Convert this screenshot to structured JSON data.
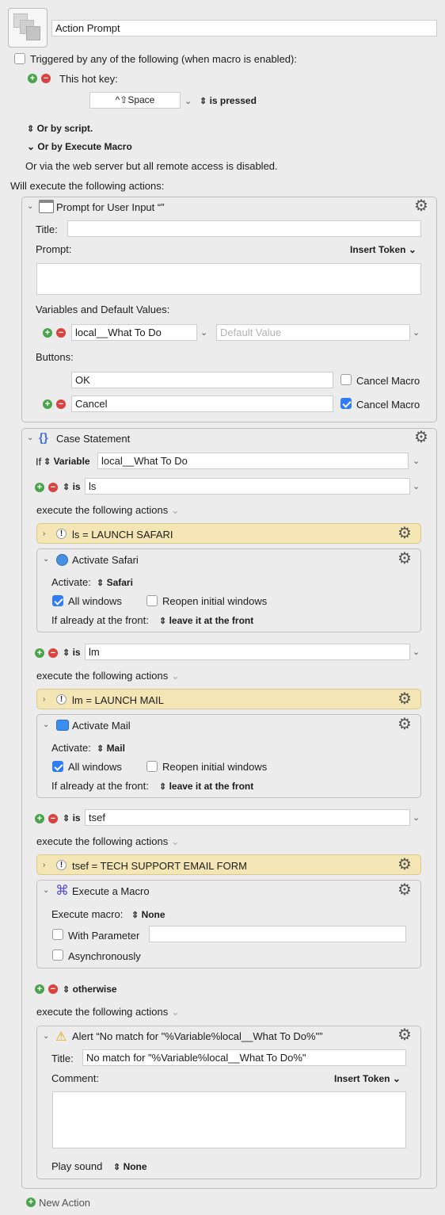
{
  "macro": {
    "name": "Action Prompt"
  },
  "trigger": {
    "triggered_label": "Triggered by any of the following (when macro is enabled):",
    "hotkey_label": "This hot key:",
    "hotkey_value": "^⇧Space",
    "hotkey_state": "is pressed",
    "or_script": "Or by script.",
    "or_execute": "Or by Execute Macro",
    "web_server": "Or via the web server but all remote access is disabled."
  },
  "will_execute": "Will execute the following actions:",
  "prompt": {
    "title": "Prompt for User Input “”",
    "title_label": "Title:",
    "prompt_label": "Prompt:",
    "insert_token": "Insert Token",
    "vars_label": "Variables and Default Values:",
    "var_name": "local__What To Do",
    "default_placeholder": "Default Value",
    "buttons_label": "Buttons:",
    "buttons": [
      {
        "label": "OK",
        "cancel": "Cancel Macro",
        "checked": false
      },
      {
        "label": "Cancel",
        "cancel": "Cancel Macro",
        "checked": true
      }
    ]
  },
  "case": {
    "title": "Case Statement",
    "if_label": "If",
    "variable_label": "Variable",
    "variable": "local__What To Do",
    "is_label": "is",
    "execute_label": "execute the following actions",
    "cases": [
      {
        "value": "ls",
        "comment": "ls = LAUNCH SAFARI",
        "action": "Activate Safari",
        "activate_label": "Activate:",
        "app": "Safari",
        "all_windows": "All windows",
        "reopen": "Reopen initial windows",
        "front_label": "If already at the front:",
        "front_value": "leave it at the front"
      },
      {
        "value": "lm",
        "comment": "lm = LAUNCH MAIL",
        "action": "Activate Mail",
        "activate_label": "Activate:",
        "app": "Mail",
        "all_windows": "All windows",
        "reopen": "Reopen initial windows",
        "front_label": "If already at the front:",
        "front_value": "leave it at the front"
      },
      {
        "value": "tsef",
        "comment": "tsef = TECH SUPPORT EMAIL FORM",
        "action": "Execute a Macro",
        "exec_label": "Execute macro:",
        "exec_value": "None",
        "with_param": "With Parameter",
        "async": "Asynchronously"
      }
    ],
    "otherwise": "otherwise",
    "alert": {
      "title": "Alert “No match for \"%Variable%local__What To Do%\"”",
      "title_label": "Title:",
      "title_value": "No match for \"%Variable%local__What To Do%\"",
      "comment_label": "Comment:",
      "insert_token": "Insert Token",
      "sound_label": "Play sound",
      "sound_value": "None"
    }
  },
  "new_action": "New Action"
}
